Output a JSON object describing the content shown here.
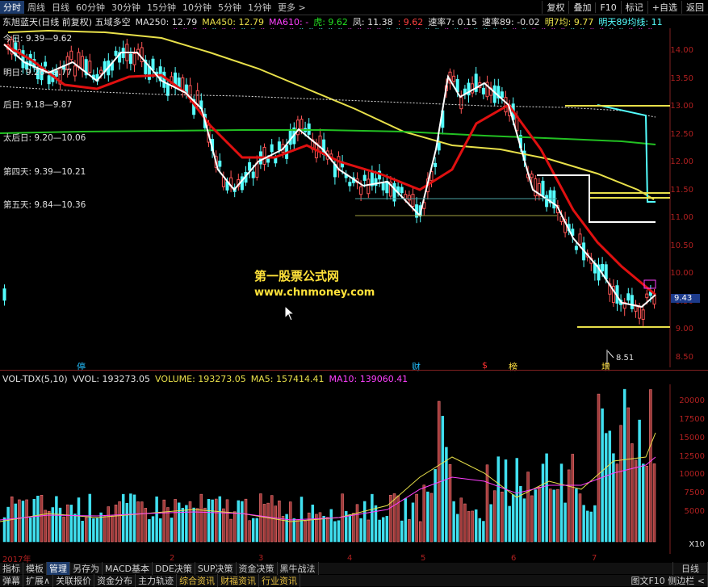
{
  "toolbar": {
    "tabs": [
      "分时",
      "周线",
      "日线",
      "60分钟",
      "30分钟",
      "15分钟",
      "10分钟",
      "5分钟",
      "1分钟",
      "更多 >"
    ],
    "right": [
      "复权",
      "叠加",
      "F10",
      "标记",
      "+自选",
      "返回"
    ]
  },
  "info": {
    "name": "东旭蓝天(日线 前复权) 五域多空",
    "ma250": "MA250: 12.79",
    "ma450": "MA450: 12.79",
    "ma610": "MA610: -",
    "tiger": "虎: 9.62",
    "phoenix": "凤: 11.38",
    "v1": ": 9.62",
    "speed7": "速率7: 0.15",
    "speed89": "速率89: -0.02",
    "tomorrow7": "明7均: 9.77",
    "tomorrow89": "明天89均线: 11"
  },
  "overlay": {
    "today": "今日: 9.39—9.62",
    "tomorrow": "明日: 9.26—9.77",
    "after": "后日: 9.18—9.87",
    "day3": "太后日: 9.20—10.06",
    "day4": "第四天: 9.39—10.21",
    "day5": "第五天: 9.84—10.36"
  },
  "watermark": {
    "line1": "第一股票公式网",
    "line2": "www.chnmoney.com"
  },
  "price_badge": "9.43",
  "low_label": "8.51",
  "yticks": [
    "14.00",
    "13.50",
    "13.00",
    "12.50",
    "12.00",
    "11.50",
    "11.00",
    "10.50",
    "10.00",
    "9.50",
    "9.00",
    "8.50"
  ],
  "markers": [
    "停",
    "财",
    "$",
    "榜",
    "增"
  ],
  "vol": {
    "title": "VOL-TDX(5,10)",
    "vvol": "VVOL: 193273.05",
    "volume": "VOLUME: 193273.05",
    "ma5": "MA5: 157414.41",
    "ma10": "MA10: 139060.41",
    "ticks": [
      "20000",
      "17500",
      "15000",
      "12500",
      "10000",
      "7500",
      "5000"
    ],
    "unit": "X10"
  },
  "xaxis": [
    "2017年",
    "2",
    "3",
    "4",
    "5",
    "6",
    "7"
  ],
  "bottom1": [
    "指标",
    "模板",
    "管理",
    "另存为",
    "MACD基本",
    "DDE决策",
    "SUP决策",
    "资金决策",
    "黑牛战法"
  ],
  "bottom1_right": "日线",
  "bottom2": [
    "弹幕",
    "扩展∧",
    "关联报价",
    "资金分布",
    "主力轨迹",
    "综合资讯",
    "财福资讯",
    "行业资讯"
  ],
  "bottom2_right": "图文F10  侧边栏 <",
  "colors": {
    "up": "#ff5555",
    "down": "#54ffff",
    "ma_yellow": "#e8e04a",
    "ma_green": "#22c022",
    "ma_red": "#e01010",
    "white": "#ffffff"
  }
}
